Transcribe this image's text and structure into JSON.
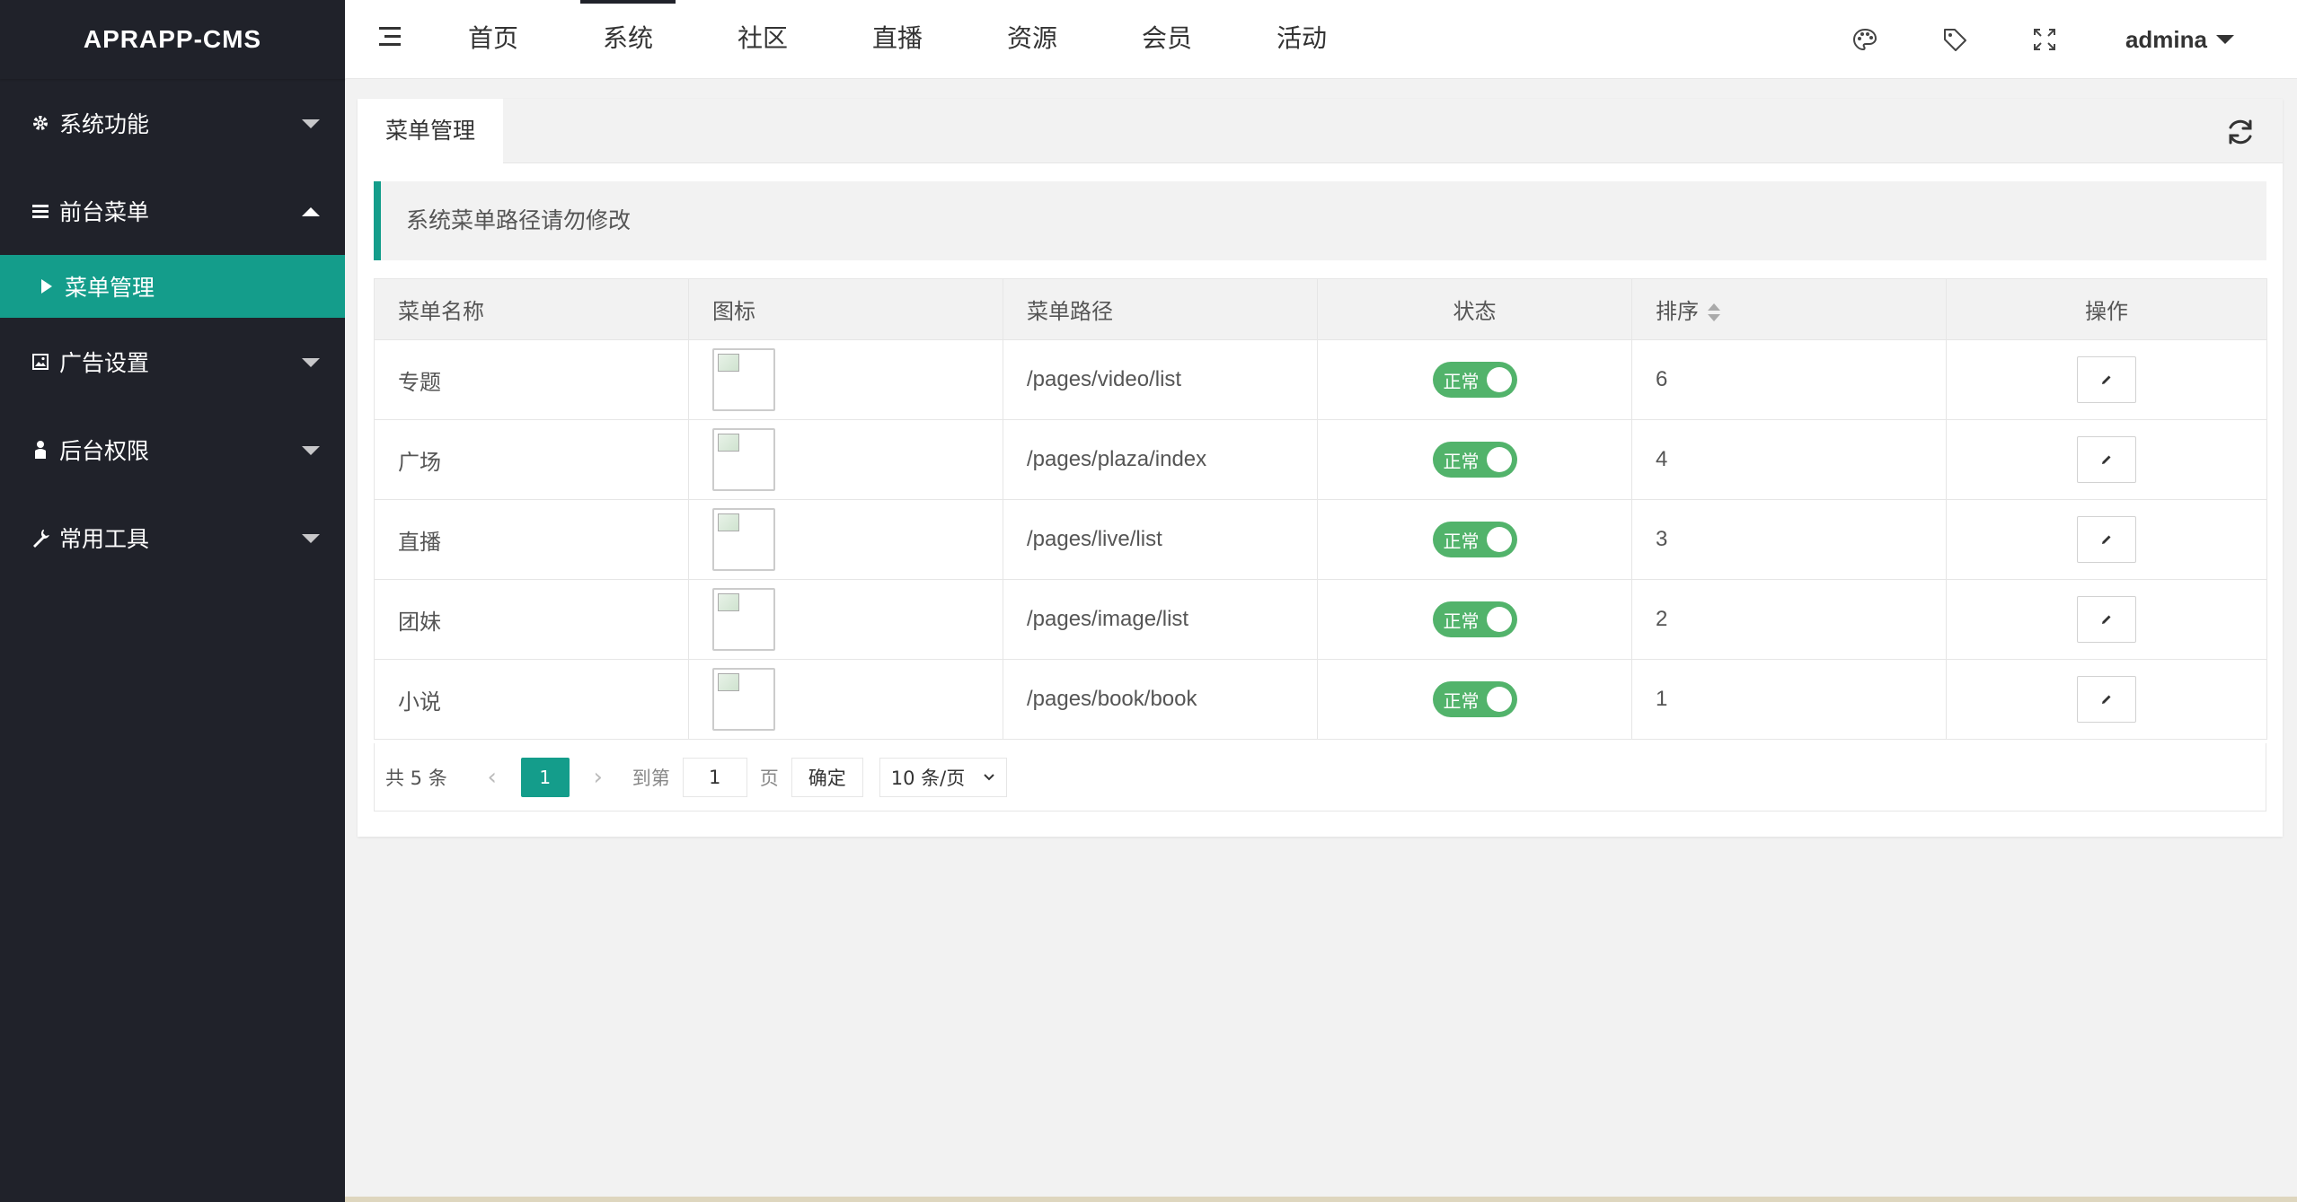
{
  "app": {
    "title": "APRAPP-CMS"
  },
  "sidebar": {
    "items": [
      {
        "label": "系统功能",
        "icon": "gear-icon",
        "state": "collapsed"
      },
      {
        "label": "前台菜单",
        "icon": "list-icon",
        "state": "expanded",
        "children": [
          {
            "label": "菜单管理",
            "active": true
          }
        ]
      },
      {
        "label": "广告设置",
        "icon": "image-icon",
        "state": "collapsed"
      },
      {
        "label": "后台权限",
        "icon": "user-icon",
        "state": "collapsed"
      },
      {
        "label": "常用工具",
        "icon": "wrench-icon",
        "state": "collapsed"
      }
    ]
  },
  "header": {
    "menu_toggle_icon": "menu-toggle-icon",
    "nav": [
      "首页",
      "系统",
      "社区",
      "直播",
      "资源",
      "会员",
      "活动"
    ],
    "active_nav": "系统",
    "icons": [
      "palette-icon",
      "tag-icon",
      "fullscreen-icon"
    ],
    "user": "admina"
  },
  "tabs": {
    "active": "菜单管理",
    "refresh_icon": "refresh-icon"
  },
  "notice": "系统菜单路径请勿修改",
  "table": {
    "headers": [
      "菜单名称",
      "图标",
      "菜单路径",
      "状态",
      "排序",
      "操作"
    ],
    "rows": [
      {
        "name": "专题",
        "path": "/pages/video/list",
        "status": "正常",
        "sort": "6"
      },
      {
        "name": "广场",
        "path": "/pages/plaza/index",
        "status": "正常",
        "sort": "4"
      },
      {
        "name": "直播",
        "path": "/pages/live/list",
        "status": "正常",
        "sort": "3"
      },
      {
        "name": "团妹",
        "path": "/pages/image/list",
        "status": "正常",
        "sort": "2"
      },
      {
        "name": "小说",
        "path": "/pages/book/book",
        "status": "正常",
        "sort": "1"
      }
    ]
  },
  "pager": {
    "total": "共 5 条",
    "prev": "‹",
    "current": "1",
    "next": "›",
    "goto_label": "到第",
    "goto_value": "1",
    "page_unit": "页",
    "confirm": "确定",
    "page_size": "10 条/页"
  },
  "colors": {
    "accent": "#149d8b",
    "sidebar": "#20222a",
    "switch_on": "#52b36b"
  }
}
